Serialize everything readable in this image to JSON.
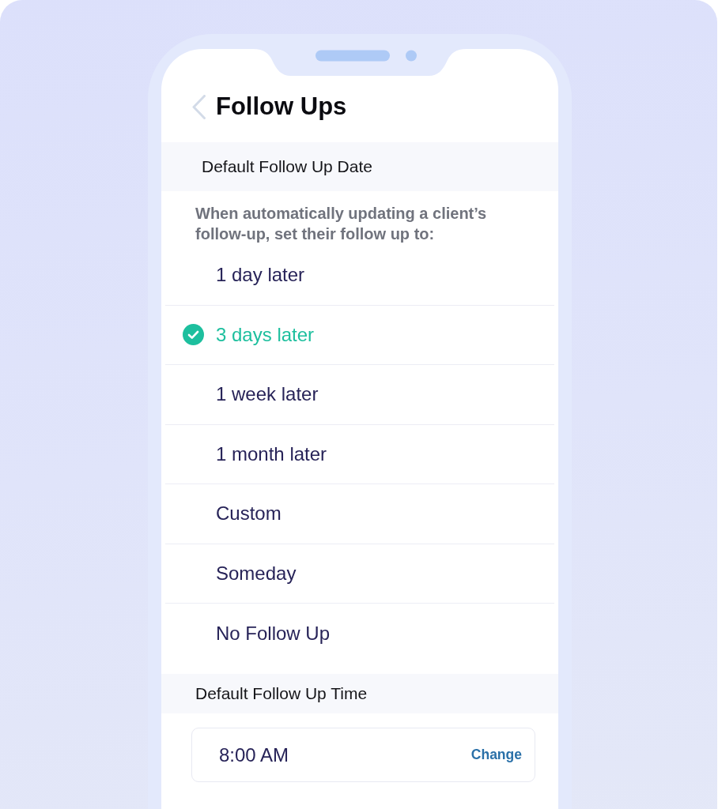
{
  "screen": {
    "title": "Follow Ups"
  },
  "date_section": {
    "heading": "Default Follow Up Date",
    "description": "When automatically updating a client’s follow-up, set their follow up to:",
    "options": [
      {
        "label": "1 day later",
        "selected": false
      },
      {
        "label": "3 days later",
        "selected": true
      },
      {
        "label": "1 week later",
        "selected": false
      },
      {
        "label": "1 month later",
        "selected": false
      },
      {
        "label": "Custom",
        "selected": false
      },
      {
        "label": "Someday",
        "selected": false
      },
      {
        "label": "No Follow Up",
        "selected": false
      }
    ]
  },
  "time_section": {
    "heading": "Default Follow Up Time",
    "value": "8:00 AM",
    "action": "Change"
  }
}
